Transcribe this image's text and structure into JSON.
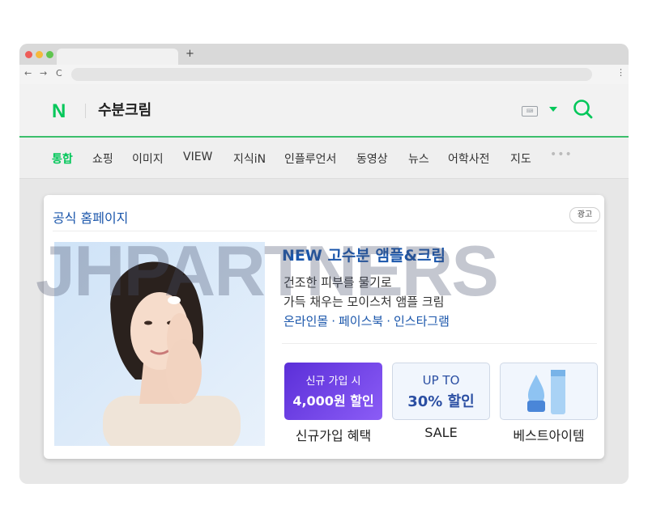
{
  "browser": {
    "new_tab": "+",
    "nav_icons": {
      "back": "←",
      "forward": "→",
      "reload": "C",
      "menu": "⋮"
    }
  },
  "naver": {
    "logo": "N",
    "query": "수분크림",
    "keyboard_icon": "keyboard-icon",
    "search_icon": "search-icon",
    "tabs": [
      "통합",
      "쇼핑",
      "이미지",
      "VIEW",
      "지식iN",
      "인플루언서",
      "동영상",
      "뉴스",
      "어학사전",
      "지도"
    ],
    "more": "•••",
    "active_tab": "통합"
  },
  "ad": {
    "section_title": "공식 홈페이지",
    "badge": "광고",
    "headline": "NEW 고수분 앰플&크림",
    "desc1": "건조한 피부를 물기로",
    "desc2": "가득 채우는 모이스처 앰플 크림",
    "links": [
      "온라인몰",
      "페이스북",
      "인스타그램"
    ],
    "link_sep": "·",
    "tiles": [
      {
        "line1": "신규 가입 시",
        "line2": "4,000원 할인",
        "caption": "신규가입 혜택"
      },
      {
        "line1": "UP TO",
        "line2": "30% 할인",
        "caption": "SALE"
      },
      {
        "caption": "베스트아이템"
      }
    ]
  },
  "watermark": "JHPARTNERS",
  "colors": {
    "naver_green": "#03c75a",
    "link_blue": "#1a56ab",
    "tile_purple": "#6a3ce0"
  }
}
